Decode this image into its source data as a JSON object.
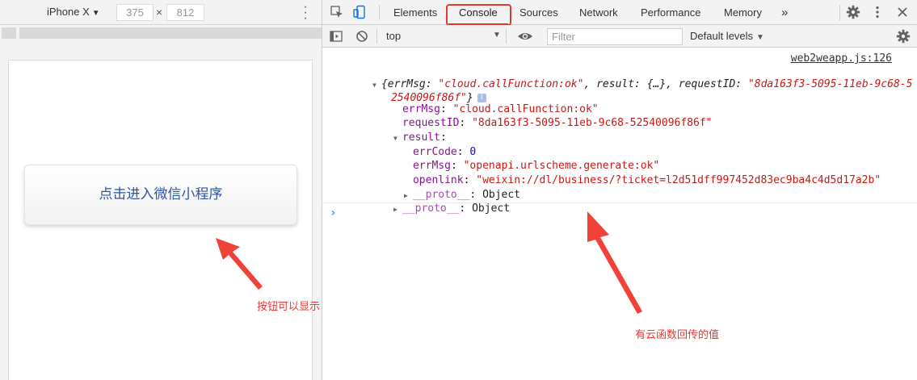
{
  "device_toolbar": {
    "device": "iPhone X",
    "width": "375",
    "height": "812",
    "times": "×"
  },
  "mini_program": {
    "button_label": "点击进入微信小程序"
  },
  "devtools": {
    "tabs": [
      "Elements",
      "Console",
      "Sources",
      "Network",
      "Performance",
      "Memory"
    ],
    "more_tabs": "»",
    "active_tab": "Console",
    "highlight_color": "#e53935"
  },
  "console_toolbar": {
    "context": "top",
    "filter_placeholder": "Filter",
    "levels": "Default levels"
  },
  "console": {
    "source": "web2weapp.js:126",
    "summary_open": "{errMsg: ",
    "summary_errmsg": "\"cloud.callFunction:ok\"",
    "summary_mid": ", result: {…}, requestID: ",
    "summary_reqid_1": "\"8da163f3-5095-11eb-9c68-5",
    "summary_reqid_2": "2540096f86f\"",
    "summary_close": "}",
    "info": "i",
    "errMsg_key": "errMsg",
    "errMsg_val": "\"cloud.callFunction:ok\"",
    "requestID_key": "requestID",
    "requestID_val": "\"8da163f3-5095-11eb-9c68-52540096f86f\"",
    "result_key": "result",
    "errCode_key": "errCode",
    "errCode_val": "0",
    "inner_errMsg_key": "errMsg",
    "inner_errMsg_val": "\"openapi.urlscheme.generate:ok\"",
    "openlink_key": "openlink",
    "openlink_val": "\"weixin://dl/business/?ticket=l2d51dff997452d83ec9ba4c4d5d17a2b\"",
    "proto_key": "__proto__",
    "proto_val": "Object",
    "colon": ": ",
    "prompt": "›"
  },
  "annotations": {
    "left_note": "按钮可以显示",
    "right_note": "有云函数回传的值"
  }
}
